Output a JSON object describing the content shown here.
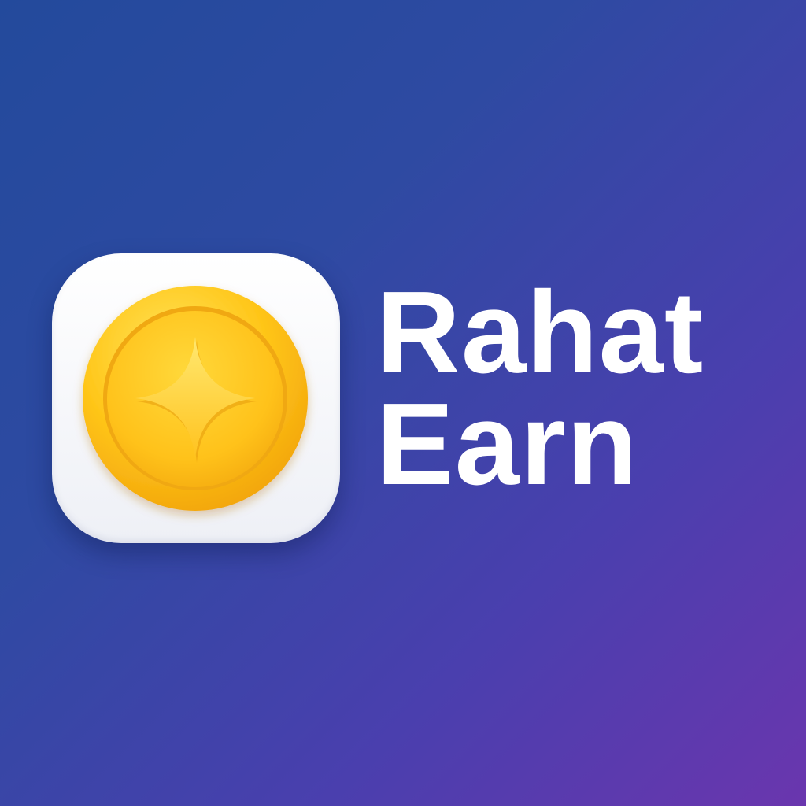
{
  "brand": {
    "line1": "Rahat",
    "line2": "Earn"
  },
  "logo": {
    "icon": "coin-star-icon",
    "tile_color": "#ffffff",
    "coin_color": "#ffc21a",
    "star_color": "#ffd93a"
  },
  "colors": {
    "background_start": "#234a9c",
    "background_end": "#6a36ae",
    "text": "#ffffff"
  }
}
